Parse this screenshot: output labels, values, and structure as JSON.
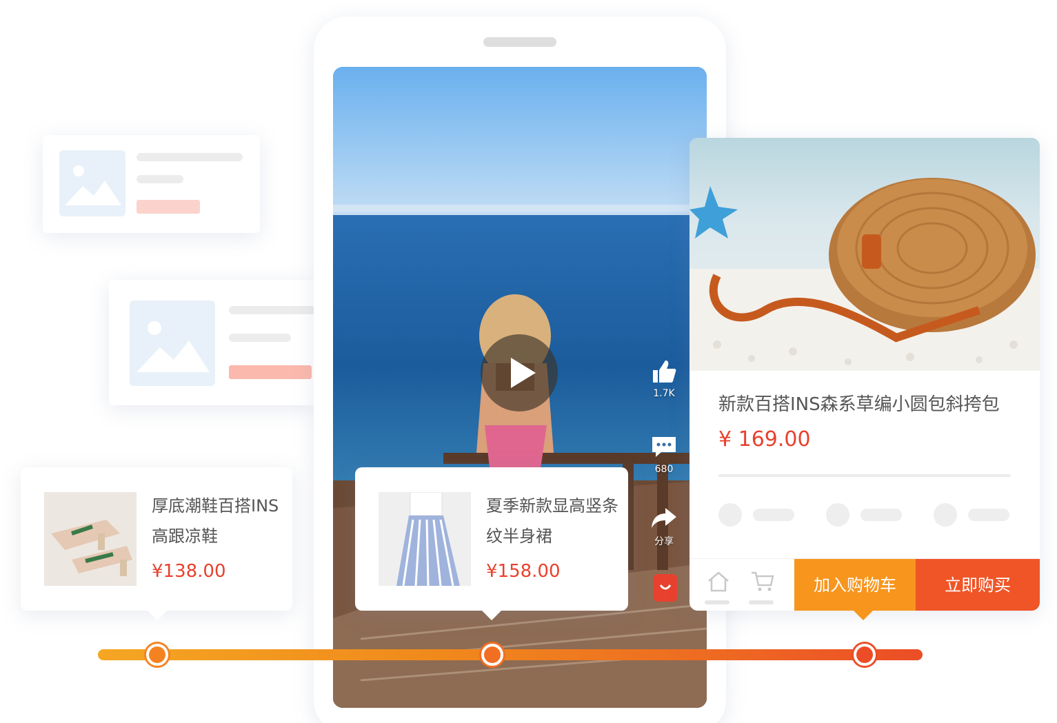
{
  "side_actions": {
    "like_count": "1.7K",
    "comment_count": "680",
    "share_label": "分享"
  },
  "products": [
    {
      "name": "厚底潮鞋百搭INS高跟凉鞋",
      "price": "¥138.00"
    },
    {
      "name": "夏季新款显高竖条纹半身裙",
      "price": "¥158.00"
    }
  ],
  "detail": {
    "title": "新款百搭INS森系草编小圆包斜挎包",
    "price": "¥ 169.00",
    "add_to_cart_label": "加入购物车",
    "buy_now_label": "立即购买"
  },
  "colors": {
    "accent_red": "#e8412d",
    "cart_orange": "#f7951d",
    "buy_red": "#ef5527"
  }
}
